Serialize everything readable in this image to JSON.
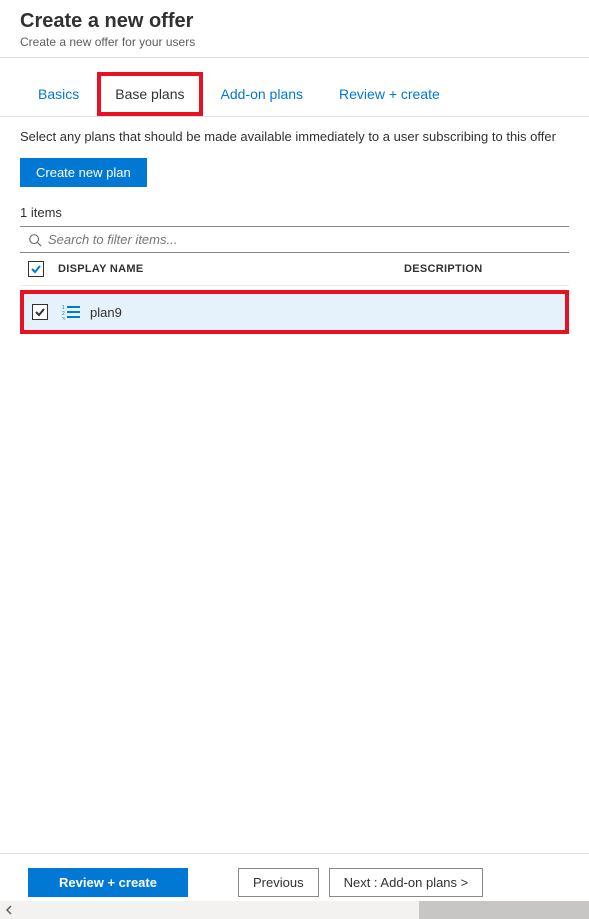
{
  "header": {
    "title": "Create a new offer",
    "subtitle": "Create a new offer for your users"
  },
  "tabs": [
    {
      "label": "Basics"
    },
    {
      "label": "Base plans"
    },
    {
      "label": "Add-on plans"
    },
    {
      "label": "Review + create"
    }
  ],
  "page": {
    "description": "Select any plans that should be made available immediately to a user subscribing to this offer",
    "create_button": "Create new plan",
    "item_count": "1 items",
    "search_placeholder": "Search to filter items..."
  },
  "table": {
    "columns": {
      "name": "DISPLAY NAME",
      "description": "DESCRIPTION"
    },
    "rows": [
      {
        "name": "plan9",
        "description": ""
      }
    ]
  },
  "footer": {
    "review": "Review + create",
    "previous": "Previous",
    "next": "Next : Add-on plans >"
  }
}
